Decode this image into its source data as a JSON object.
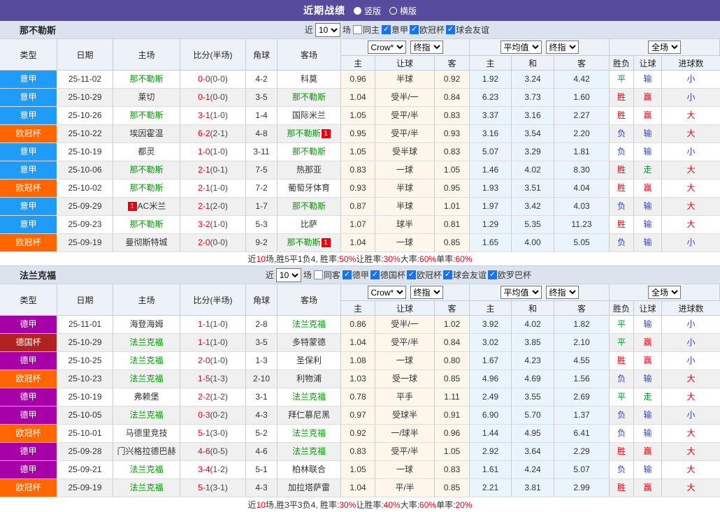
{
  "topbar": {
    "title": "近期战绩",
    "options": [
      {
        "label": "竖版",
        "selected": true
      },
      {
        "label": "横版",
        "selected": false
      }
    ]
  },
  "columns": {
    "type": "类型",
    "date": "日期",
    "home": "主场",
    "score": "比分(半场)",
    "corner": "角球",
    "away": "客场",
    "crow_home": "主",
    "handicap": "让球",
    "crow_away": "客",
    "avg_home": "主",
    "avg_draw": "和",
    "avg_away": "客",
    "result": "胜负",
    "handicap_result": "让球",
    "goals": "进球数"
  },
  "selects": {
    "count": "10",
    "crow": "Crow*",
    "crow_idx": "终指",
    "avg": "平均值",
    "avg_idx": "终指",
    "period": "全场"
  },
  "filter_labels": {
    "near": "近",
    "games": "场"
  },
  "league_colors": {
    "意甲": "#1f9cf8",
    "欧冠杯": "#ff6600",
    "德甲": "#a800a8",
    "德国杯": "#b22222"
  },
  "outcome_colors": {
    "胜": "#e60012",
    "平": "#009933",
    "负": "#3344cc",
    "赢": "#e60012",
    "走": "#009933",
    "输": "#3344cc",
    "大": "#e60012",
    "小": "#3344cc"
  },
  "colors": {
    "topbar": "#574b9e",
    "team_green": "#009900",
    "score_red": "#e60012",
    "badge_red": "#e60012"
  },
  "tables": [
    {
      "team": "那不勒斯",
      "same_label": "同主",
      "same_checked": false,
      "leagues": [
        "意甲",
        "欧冠杯",
        "球会友谊"
      ],
      "rows": [
        {
          "lg": "意甲",
          "date": "25-11-02",
          "h": "那不勒斯",
          "hg": 1,
          "a": "科莫",
          "s": "0-0",
          "hs": "(0-0)",
          "c": "4-2",
          "o1": "0.96",
          "hc": "半球",
          "o2": "0.92",
          "m1": "1.92",
          "m2": "3.24",
          "m3": "4.42",
          "r1": "平",
          "r2": "输",
          "r3": "小"
        },
        {
          "lg": "意甲",
          "date": "25-10-29",
          "h": "莱切",
          "a": "那不勒斯",
          "ag": 1,
          "s": "0-1",
          "hs": "(0-0)",
          "c": "3-5",
          "o1": "1.04",
          "hc": "受半/一",
          "o2": "0.84",
          "m1": "6.23",
          "m2": "3.73",
          "m3": "1.60",
          "r1": "胜",
          "r2": "赢",
          "r3": "小"
        },
        {
          "lg": "意甲",
          "date": "25-10-26",
          "h": "那不勒斯",
          "hg": 1,
          "a": "国际米兰",
          "s": "3-1",
          "hs": "(1-0)",
          "c": "1-4",
          "o1": "1.05",
          "hc": "受平/半",
          "o2": "0.83",
          "m1": "3.37",
          "m2": "3.16",
          "m3": "2.27",
          "r1": "胜",
          "r2": "赢",
          "r3": "大"
        },
        {
          "lg": "欧冠杯",
          "date": "25-10-22",
          "h": "埃因霍温",
          "a": "那不勒斯",
          "ag": 1,
          "ab": "1",
          "s": "6-2",
          "hs": "(2-1)",
          "c": "4-8",
          "o1": "0.95",
          "hc": "受平/半",
          "o2": "0.93",
          "m1": "3.16",
          "m2": "3.54",
          "m3": "2.20",
          "r1": "负",
          "r2": "输",
          "r3": "大"
        },
        {
          "lg": "意甲",
          "date": "25-10-19",
          "h": "都灵",
          "a": "那不勒斯",
          "ag": 1,
          "s": "1-0",
          "hs": "(1-0)",
          "c": "3-11",
          "o1": "1.05",
          "hc": "受半球",
          "o2": "0.83",
          "m1": "5.07",
          "m2": "3.29",
          "m3": "1.81",
          "r1": "负",
          "r2": "输",
          "r3": "小"
        },
        {
          "lg": "意甲",
          "date": "25-10-06",
          "h": "那不勒斯",
          "hg": 1,
          "a": "热那亚",
          "s": "2-1",
          "hs": "(0-1)",
          "c": "7-5",
          "o1": "0.83",
          "hc": "一球",
          "o2": "1.05",
          "m1": "1.46",
          "m2": "4.02",
          "m3": "8.30",
          "r1": "胜",
          "r2": "走",
          "r3": "大"
        },
        {
          "lg": "欧冠杯",
          "date": "25-10-02",
          "h": "那不勒斯",
          "hg": 1,
          "a": "葡萄牙体育",
          "s": "2-1",
          "hs": "(1-0)",
          "c": "7-2",
          "o1": "0.93",
          "hc": "半球",
          "o2": "0.95",
          "m1": "1.93",
          "m2": "3.51",
          "m3": "4.04",
          "r1": "胜",
          "r2": "赢",
          "r3": "大"
        },
        {
          "lg": "意甲",
          "date": "25-09-29",
          "h": "AC米兰",
          "hb": "1",
          "hbp": "before",
          "a": "那不勒斯",
          "ag": 1,
          "s": "2-1",
          "hs": "(2-0)",
          "c": "1-7",
          "o1": "0.87",
          "hc": "半球",
          "o2": "1.01",
          "m1": "1.97",
          "m2": "3.42",
          "m3": "4.03",
          "r1": "负",
          "r2": "输",
          "r3": "大"
        },
        {
          "lg": "意甲",
          "date": "25-09-23",
          "h": "那不勒斯",
          "hg": 1,
          "a": "比萨",
          "s": "3-2",
          "hs": "(1-0)",
          "c": "5-3",
          "o1": "1.07",
          "hc": "球半",
          "o2": "0.81",
          "m1": "1.29",
          "m2": "5.35",
          "m3": "11.23",
          "r1": "胜",
          "r2": "输",
          "r3": "大"
        },
        {
          "lg": "欧冠杯",
          "date": "25-09-19",
          "h": "曼彻斯特城",
          "a": "那不勒斯",
          "ag": 1,
          "ab": "1",
          "s": "2-0",
          "hs": "(0-0)",
          "c": "9-2",
          "o1": "1.04",
          "hc": "一球",
          "o2": "0.85",
          "m1": "1.65",
          "m2": "4.00",
          "m3": "5.05",
          "r1": "负",
          "r2": "输",
          "r3": "小"
        }
      ],
      "summary": [
        {
          "t": "近",
          "c": "k"
        },
        {
          "t": "10",
          "c": "r"
        },
        {
          "t": "场,胜5平1负4, 胜率:",
          "c": "k"
        },
        {
          "t": "50%",
          "c": "r"
        },
        {
          "t": " 让胜率:",
          "c": "k"
        },
        {
          "t": "30%",
          "c": "r"
        },
        {
          "t": " 大率:",
          "c": "k"
        },
        {
          "t": "60%",
          "c": "r"
        },
        {
          "t": " 单率:",
          "c": "k"
        },
        {
          "t": "60%",
          "c": "r"
        }
      ]
    },
    {
      "team": "法兰克福",
      "same_label": "同客",
      "same_checked": false,
      "leagues": [
        "德甲",
        "德国杯",
        "欧冠杯",
        "球会友谊",
        "欧罗巴杯"
      ],
      "rows": [
        {
          "lg": "德甲",
          "date": "25-11-01",
          "h": "海登海姆",
          "a": "法兰克福",
          "ag": 1,
          "s": "1-1",
          "hs": "(1-0)",
          "c": "2-8",
          "o1": "0.86",
          "hc": "受半/一",
          "o2": "1.02",
          "m1": "3.92",
          "m2": "4.02",
          "m3": "1.82",
          "r1": "平",
          "r2": "输",
          "r3": "小"
        },
        {
          "lg": "德国杯",
          "date": "25-10-29",
          "h": "法兰克福",
          "hg": 1,
          "a": "多特蒙德",
          "s": "1-1",
          "hs": "(1-0)",
          "c": "3-5",
          "o1": "1.04",
          "hc": "受平/半",
          "o2": "0.84",
          "m1": "3.02",
          "m2": "3.85",
          "m3": "2.10",
          "r1": "平",
          "r2": "赢",
          "r3": "小"
        },
        {
          "lg": "德甲",
          "date": "25-10-25",
          "h": "法兰克福",
          "hg": 1,
          "a": "圣保利",
          "s": "2-0",
          "hs": "(1-0)",
          "c": "1-3",
          "o1": "1.08",
          "hc": "一球",
          "o2": "0.80",
          "m1": "1.67",
          "m2": "4.23",
          "m3": "4.55",
          "r1": "胜",
          "r2": "赢",
          "r3": "小"
        },
        {
          "lg": "欧冠杯",
          "date": "25-10-23",
          "h": "法兰克福",
          "hg": 1,
          "a": "利物浦",
          "s": "1-5",
          "hs": "(1-3)",
          "c": "2-10",
          "o1": "1.03",
          "hc": "受一球",
          "o2": "0.85",
          "m1": "4.96",
          "m2": "4.69",
          "m3": "1.56",
          "r1": "负",
          "r2": "输",
          "r3": "大"
        },
        {
          "lg": "德甲",
          "date": "25-10-19",
          "h": "弗赖堡",
          "a": "法兰克福",
          "ag": 1,
          "s": "2-2",
          "hs": "(1-2)",
          "c": "3-1",
          "o1": "0.78",
          "hc": "平手",
          "o2": "1.11",
          "m1": "2.49",
          "m2": "3.55",
          "m3": "2.69",
          "r1": "平",
          "r2": "走",
          "r3": "大"
        },
        {
          "lg": "德甲",
          "date": "25-10-05",
          "h": "法兰克福",
          "hg": 1,
          "a": "拜仁慕尼黑",
          "s": "0-3",
          "hs": "(0-2)",
          "c": "4-3",
          "o1": "0.97",
          "hc": "受球半",
          "o2": "0.91",
          "m1": "6.90",
          "m2": "5.70",
          "m3": "1.37",
          "r1": "负",
          "r2": "输",
          "r3": "小"
        },
        {
          "lg": "欧冠杯",
          "date": "25-10-01",
          "h": "马德里竞技",
          "a": "法兰克福",
          "ag": 1,
          "s": "5-1",
          "hs": "(3-0)",
          "c": "5-2",
          "o1": "0.92",
          "hc": "一/球半",
          "o2": "0.96",
          "m1": "1.44",
          "m2": "4.95",
          "m3": "6.41",
          "r1": "负",
          "r2": "输",
          "r3": "大"
        },
        {
          "lg": "德甲",
          "date": "25-09-28",
          "h": "门兴格拉德巴赫",
          "a": "法兰克福",
          "ag": 1,
          "s": "4-6",
          "hs": "(0-5)",
          "c": "4-6",
          "o1": "0.83",
          "hc": "受平/半",
          "o2": "1.05",
          "m1": "2.92",
          "m2": "3.64",
          "m3": "2.29",
          "r1": "胜",
          "r2": "赢",
          "r3": "大"
        },
        {
          "lg": "德甲",
          "date": "25-09-21",
          "h": "法兰克福",
          "hg": 1,
          "a": "柏林联合",
          "s": "3-4",
          "hs": "(1-2)",
          "c": "5-1",
          "o1": "1.05",
          "hc": "一球",
          "o2": "0.83",
          "m1": "1.61",
          "m2": "4.24",
          "m3": "5.07",
          "r1": "负",
          "r2": "输",
          "r3": "大"
        },
        {
          "lg": "欧冠杯",
          "date": "25-09-19",
          "h": "法兰克福",
          "hg": 1,
          "a": "加拉塔萨雷",
          "s": "5-1",
          "hs": "(3-1)",
          "c": "4-3",
          "o1": "1.04",
          "hc": "平/半",
          "o2": "0.85",
          "m1": "2.21",
          "m2": "3.81",
          "m3": "2.99",
          "r1": "胜",
          "r2": "赢",
          "r3": "大"
        }
      ],
      "summary": [
        {
          "t": "近",
          "c": "k"
        },
        {
          "t": "10",
          "c": "r"
        },
        {
          "t": "场,胜3平3负4, 胜率:",
          "c": "k"
        },
        {
          "t": "30%",
          "c": "r"
        },
        {
          "t": " 让胜率:",
          "c": "k"
        },
        {
          "t": "40%",
          "c": "r"
        },
        {
          "t": " 大率:",
          "c": "k"
        },
        {
          "t": "60%",
          "c": "r"
        },
        {
          "t": " 单率:",
          "c": "k"
        },
        {
          "t": "20%",
          "c": "r"
        }
      ]
    }
  ]
}
